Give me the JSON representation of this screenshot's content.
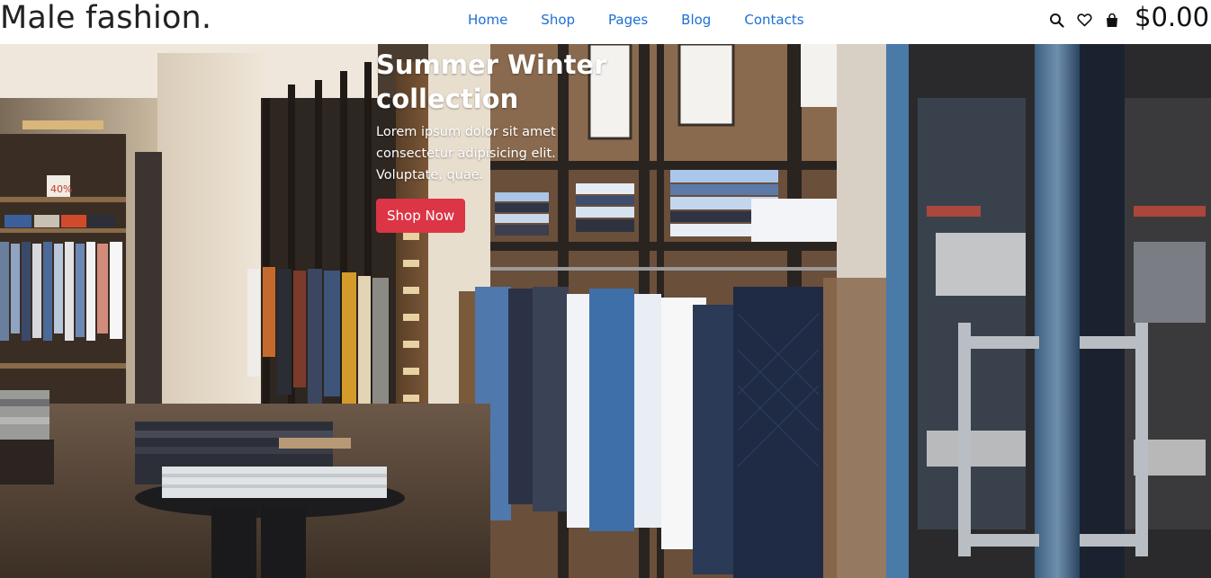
{
  "header": {
    "brand": "Male fashion.",
    "nav": [
      {
        "label": "Home"
      },
      {
        "label": "Shop"
      },
      {
        "label": "Pages"
      },
      {
        "label": "Blog"
      },
      {
        "label": "Contacts"
      }
    ],
    "icons": [
      "search-icon",
      "heart-icon",
      "shopping-bag-icon"
    ],
    "cart_total": "$0.00"
  },
  "hero": {
    "title": "Summer Winter collection",
    "description": "Lorem ipsum dolor sit amet consectetur adipisicing elit. Voluptate, quae.",
    "button_label": "Shop Now",
    "store_sign": "40%"
  },
  "colors": {
    "nav_link": "#1c6fd4",
    "button": "#dc3545",
    "brand_text": "#222222"
  }
}
